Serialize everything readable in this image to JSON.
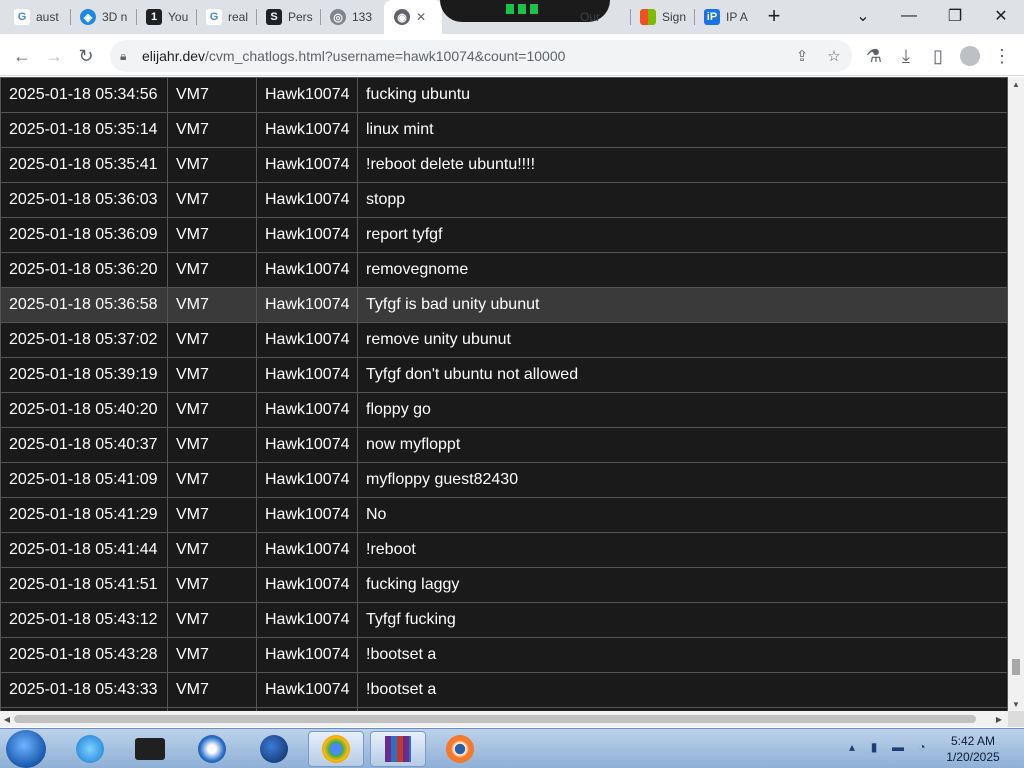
{
  "tabs": [
    {
      "label": "aust",
      "icon": "google-icon"
    },
    {
      "label": "3D n",
      "icon": "3d-viewer-icon"
    },
    {
      "label": "You",
      "icon": "one-icon"
    },
    {
      "label": "real",
      "icon": "google-icon"
    },
    {
      "label": "Pers",
      "icon": "s-site-icon"
    },
    {
      "label": "133",
      "icon": "globe-icon"
    },
    {
      "label": "",
      "icon": "active-site-icon"
    },
    {
      "label": "",
      "icon": "close-icon"
    },
    {
      "label": "Our",
      "icon": "site-icon"
    },
    {
      "label": "Sign",
      "icon": "microsoft-icon"
    },
    {
      "label": "IP A",
      "icon": "ip-icon"
    }
  ],
  "toolbar": {
    "url_host": "elijahr.dev",
    "url_path": "/cvm_chatlogs.html?username=hawk10074&count=10000"
  },
  "rows": [
    {
      "time": "2025-01-18 05:34:56",
      "vm": "VM7",
      "user": "Hawk10074",
      "msg": "fucking ubuntu"
    },
    {
      "time": "2025-01-18 05:35:14",
      "vm": "VM7",
      "user": "Hawk10074",
      "msg": "linux mint"
    },
    {
      "time": "2025-01-18 05:35:41",
      "vm": "VM7",
      "user": "Hawk10074",
      "msg": "!reboot delete ubuntu!!!!"
    },
    {
      "time": "2025-01-18 05:36:03",
      "vm": "VM7",
      "user": "Hawk10074",
      "msg": "stopp"
    },
    {
      "time": "2025-01-18 05:36:09",
      "vm": "VM7",
      "user": "Hawk10074",
      "msg": "report tyfgf"
    },
    {
      "time": "2025-01-18 05:36:20",
      "vm": "VM7",
      "user": "Hawk10074",
      "msg": "removegnome"
    },
    {
      "time": "2025-01-18 05:36:58",
      "vm": "VM7",
      "user": "Hawk10074",
      "msg": "Tyfgf is bad unity ubunut"
    },
    {
      "time": "2025-01-18 05:37:02",
      "vm": "VM7",
      "user": "Hawk10074",
      "msg": "remove unity ubunut"
    },
    {
      "time": "2025-01-18 05:39:19",
      "vm": "VM7",
      "user": "Hawk10074",
      "msg": "Tyfgf don't ubuntu not allowed"
    },
    {
      "time": "2025-01-18 05:40:20",
      "vm": "VM7",
      "user": "Hawk10074",
      "msg": "floppy go"
    },
    {
      "time": "2025-01-18 05:40:37",
      "vm": "VM7",
      "user": "Hawk10074",
      "msg": "now myfloppt"
    },
    {
      "time": "2025-01-18 05:41:09",
      "vm": "VM7",
      "user": "Hawk10074",
      "msg": "myfloppy guest82430"
    },
    {
      "time": "2025-01-18 05:41:29",
      "vm": "VM7",
      "user": "Hawk10074",
      "msg": "No"
    },
    {
      "time": "2025-01-18 05:41:44",
      "vm": "VM7",
      "user": "Hawk10074",
      "msg": "!reboot"
    },
    {
      "time": "2025-01-18 05:41:51",
      "vm": "VM7",
      "user": "Hawk10074",
      "msg": "fucking laggy"
    },
    {
      "time": "2025-01-18 05:43:12",
      "vm": "VM7",
      "user": "Hawk10074",
      "msg": "Tyfgf fucking"
    },
    {
      "time": "2025-01-18 05:43:28",
      "vm": "VM7",
      "user": "Hawk10074",
      "msg": "!bootset a"
    },
    {
      "time": "2025-01-18 05:43:33",
      "vm": "VM7",
      "user": "Hawk10074",
      "msg": "!bootset a"
    },
    {
      "time": "",
      "vm": "",
      "user": "",
      "msg": ""
    }
  ],
  "taskbar": {
    "clock_time": "5:42 AM",
    "clock_date": "1/20/2025"
  }
}
